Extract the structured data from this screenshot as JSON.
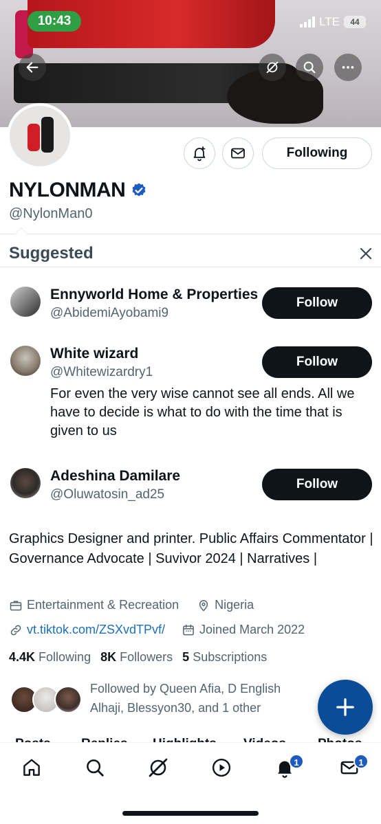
{
  "status_bar": {
    "time": "10:43",
    "network": "LTE",
    "battery": "44"
  },
  "header": {
    "back": "back",
    "grok": "grok",
    "search": "search",
    "more": "more"
  },
  "profile": {
    "name": "NYLONMAN",
    "handle": "@NylonMan0",
    "following_button": "Following",
    "bio": "Graphics Designer and printer. Public Affairs Commentator | Governance Advocate | Suvivor 2024 | Narratives |",
    "category": "Entertainment & Recreation",
    "location": "Nigeria",
    "link": "vt.tiktok.com/ZSXvdTPvf/",
    "joined": "Joined March 2022",
    "following_count": "4.4K",
    "following_label": "Following",
    "followers_count": "8K",
    "followers_label": "Followers",
    "subscriptions_count": "5",
    "subscriptions_label": "Subscriptions",
    "followed_by": "Followed by Queen Afia, D English Alhaji, Blessyon30, and 1 other"
  },
  "suggested": {
    "title": "Suggested",
    "items": [
      {
        "name": "Ennyworld Home & Properties",
        "handle": "@AbidemiAyobami9",
        "bio": "",
        "button": "Follow"
      },
      {
        "name": "White wizard",
        "handle": "@Whitewizardry1",
        "bio": "For even the very wise cannot see all ends. All we have to decide is what to do with the time that is given to us",
        "button": "Follow"
      },
      {
        "name": "Adeshina Damilare",
        "handle": "@Oluwatosin_ad25",
        "bio": "",
        "button": "Follow"
      }
    ]
  },
  "tabs": [
    "Posts",
    "Replies",
    "Highlights",
    "Videos",
    "Photos"
  ],
  "nav": {
    "notifications_badge": "1",
    "messages_badge": "1"
  },
  "colors": {
    "accent": "#1d9bf0",
    "fab": "#0b4c99",
    "verified": "#1d5bbf",
    "time_pill": "#2f9e44"
  }
}
